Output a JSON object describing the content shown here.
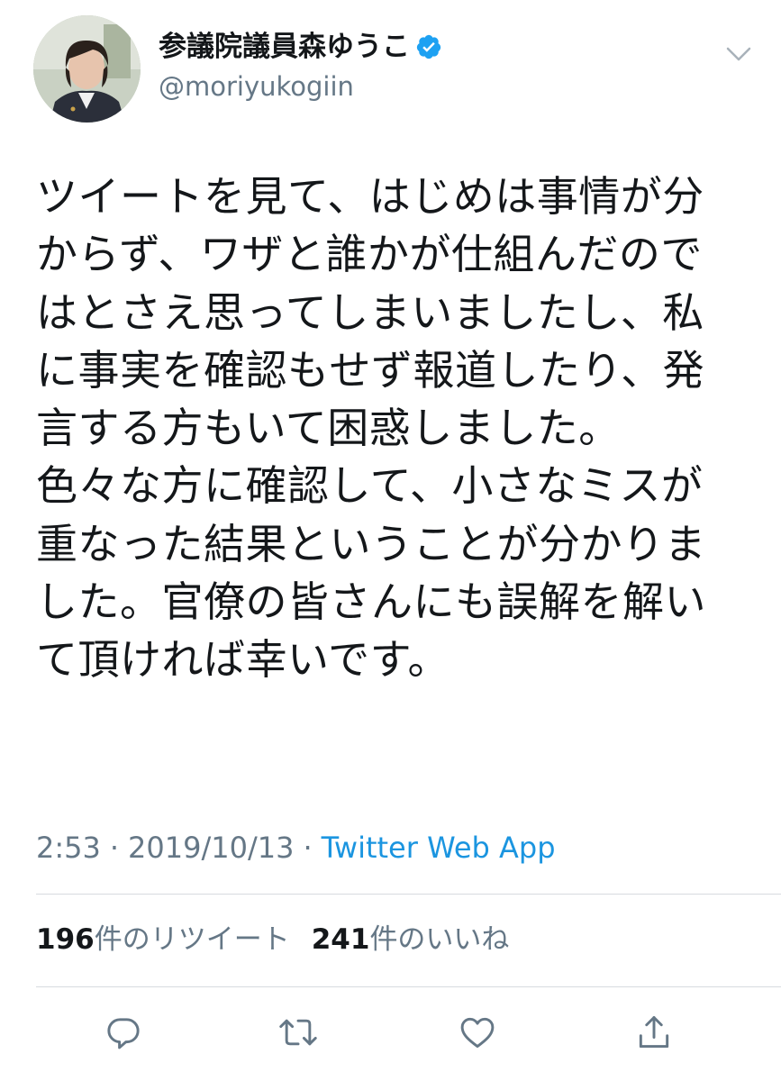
{
  "user": {
    "display_name": "参議院議員森ゆうこ",
    "handle": "@moriyukogiin",
    "verified": true
  },
  "tweet": {
    "lines": [
      "ツイートを見て、はじめは事情が分",
      "からず、ワザと誰かが仕組んだので",
      "はとさえ思ってしまいましたし、私",
      "に事実を確認もせず報道したり、発",
      "言する方もいて困惑しました。",
      "色々な方に確認して、小さなミスが",
      "重なった結果ということが分かりま",
      "した。官僚の皆さんにも誤解を解い",
      "て頂ければ幸いです。"
    ],
    "time": "2:53",
    "date": "2019/10/13",
    "separator": "·",
    "source": "Twitter Web App"
  },
  "stats": {
    "retweet_count": "196",
    "retweet_label": "件のリツイート",
    "like_count": "241",
    "like_label": "件のいいね"
  },
  "icons": {
    "verified": "verified-badge-icon",
    "caret": "chevron-down-icon",
    "reply": "reply-icon",
    "retweet": "retweet-icon",
    "like": "heart-icon",
    "share": "share-icon"
  },
  "colors": {
    "text": "#14171a",
    "secondary": "#657786",
    "link": "#1b95e0",
    "verified": "#1da1f2",
    "icon": "#657786"
  }
}
